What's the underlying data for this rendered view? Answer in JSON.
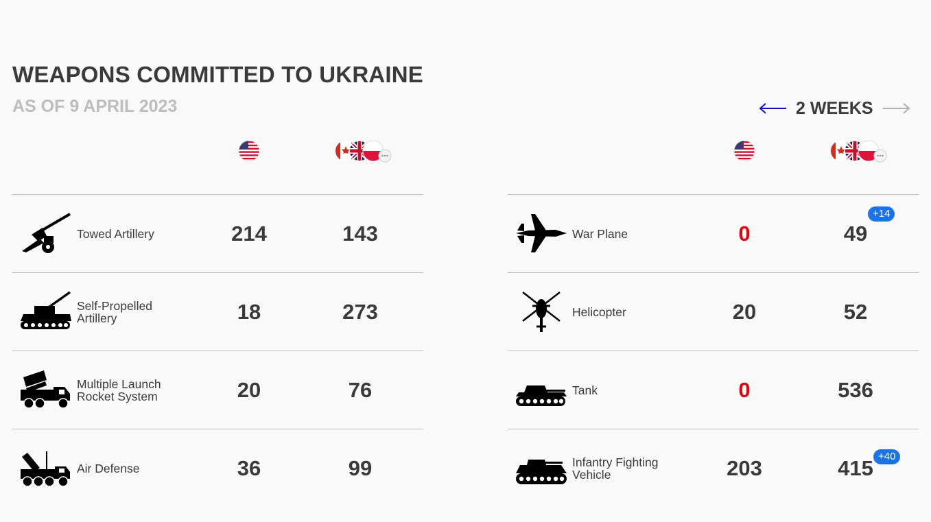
{
  "header": {
    "title": "WEAPONS COMMITTED TO UKRAINE",
    "subtitle": "AS OF 9 APRIL 2023"
  },
  "nav": {
    "label": "2 WEEKS",
    "prev_color": "#1010c8",
    "next_color": "#b0b0b0"
  },
  "columns": {
    "a_flag": "us-flag-icon",
    "b_flags": [
      "canada-flag-icon",
      "uk-flag-icon",
      "poland-flag-icon",
      "more-icon"
    ]
  },
  "left_rows": [
    {
      "icon": "towed-artillery-icon",
      "label": "Towed Artillery",
      "a": "214",
      "b": "143"
    },
    {
      "icon": "self-propelled-artillery-icon",
      "label": "Self-Propelled Artillery",
      "a": "18",
      "b": "273"
    },
    {
      "icon": "rocket-system-icon",
      "label": "Multiple Launch Rocket System",
      "a": "20",
      "b": "76"
    },
    {
      "icon": "air-defense-icon",
      "label": "Air Defense",
      "a": "36",
      "b": "99"
    }
  ],
  "right_rows": [
    {
      "icon": "war-plane-icon",
      "label": "War Plane",
      "a": "0",
      "b": "49",
      "badge": "+14"
    },
    {
      "icon": "helicopter-icon",
      "label": "Helicopter",
      "a": "20",
      "b": "52"
    },
    {
      "icon": "tank-icon",
      "label": "Tank",
      "a": "0",
      "b": "536"
    },
    {
      "icon": "ifv-icon",
      "label": "Infantry Fighting Vehicle",
      "a": "203",
      "b": "415",
      "badge": "+40"
    }
  ],
  "colors": {
    "zero": "#e8000b",
    "badge": "#1a73e8",
    "text": "#3a3a3a",
    "muted": "#bdbdbd"
  }
}
